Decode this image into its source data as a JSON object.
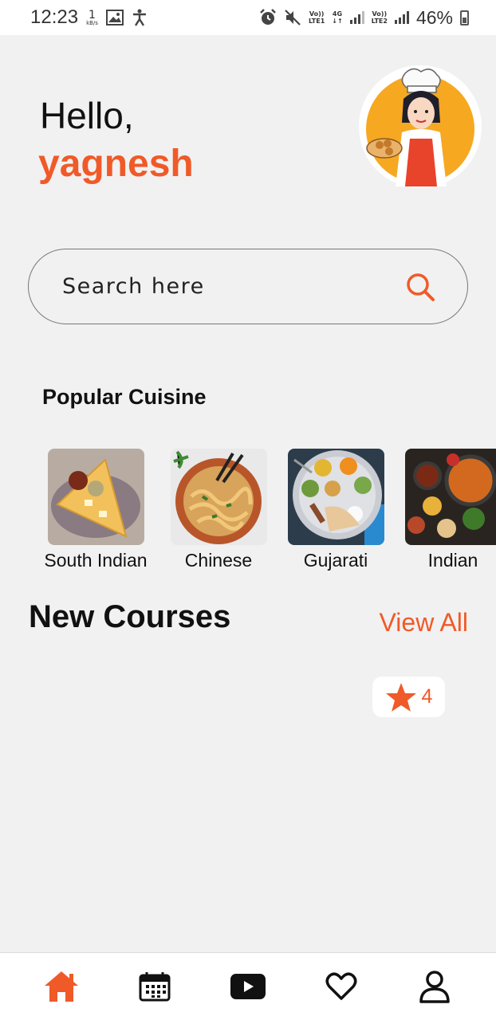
{
  "colors": {
    "accent": "#f05a28",
    "text": "#111111",
    "background": "#f1f1f1"
  },
  "status_bar": {
    "time": "12:23",
    "data_speed": "1",
    "data_unit": "kB/s",
    "sim1_label": "VoLTE LTE1",
    "network": "4G",
    "sim2_label": "VoLTE LTE2",
    "battery": "46%"
  },
  "header": {
    "greeting": "Hello,",
    "username": "yagnesh",
    "avatar_icon": "chef-avatar"
  },
  "search": {
    "placeholder": "Search here",
    "icon": "search-icon"
  },
  "popular": {
    "title": "Popular Cuisine",
    "items": [
      {
        "label": "South Indian",
        "image": "dosa-image"
      },
      {
        "label": "Chinese",
        "image": "noodles-image"
      },
      {
        "label": "Gujarati",
        "image": "thali-image"
      },
      {
        "label": "Indian",
        "image": "curry-spread-image"
      }
    ]
  },
  "courses": {
    "title": "New Courses",
    "view_all": "View All",
    "rating": "4"
  },
  "nav": [
    {
      "icon": "home-icon",
      "active": true
    },
    {
      "icon": "calendar-icon",
      "active": false
    },
    {
      "icon": "play-video-icon",
      "active": false
    },
    {
      "icon": "heart-icon",
      "active": false
    },
    {
      "icon": "profile-icon",
      "active": false
    }
  ]
}
